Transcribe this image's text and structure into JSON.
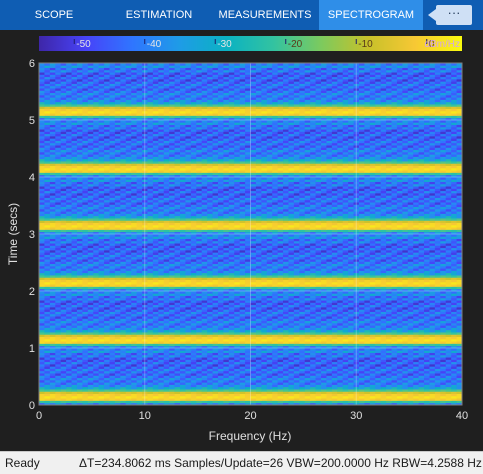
{
  "tabs": [
    {
      "label": "SCOPE",
      "active": false
    },
    {
      "label": "ESTIMATION",
      "active": false
    },
    {
      "label": "MEASUREMENTS",
      "active": false
    },
    {
      "label": "SPECTROGRAM",
      "active": true
    }
  ],
  "more_button": {
    "label": "···"
  },
  "colorbar": {
    "ticks": [
      "-50",
      "-40",
      "-30",
      "-20",
      "-10",
      "0"
    ],
    "unit": "dBm/Hz"
  },
  "status": {
    "ready": "Ready",
    "metrics": "ΔT=234.8062 ms  Samples/Update=26  VBW=200.0000 Hz  RBW=4.2588 Hz"
  },
  "chart_data": {
    "type": "heatmap",
    "xlabel": "Frequency (Hz)",
    "ylabel": "Time (secs)",
    "x_ticks": [
      "0",
      "10",
      "20",
      "30",
      "40"
    ],
    "y_ticks": [
      "0",
      "1",
      "2",
      "3",
      "4",
      "5",
      "6"
    ],
    "xlim": [
      0,
      40
    ],
    "ylim": [
      0,
      6
    ],
    "zlim": [
      -55,
      5
    ],
    "grid": true,
    "colormap": [
      "#3e26a8",
      "#4743f8",
      "#2f76ff",
      "#1e9ce6",
      "#0bb2c2",
      "#33c3a0",
      "#7cca5e",
      "#c7c12a",
      "#f7c834",
      "#f9fb0e"
    ],
    "period_secs": 1.0,
    "profile": [
      {
        "t": 0.0,
        "db": -44
      },
      {
        "t": 0.05,
        "db": -30
      },
      {
        "t": 0.08,
        "db": -5
      },
      {
        "t": 0.1,
        "db": -1
      },
      {
        "t": 0.14,
        "db": 1
      },
      {
        "t": 0.18,
        "db": -1
      },
      {
        "t": 0.22,
        "db": -6
      },
      {
        "t": 0.26,
        "db": -20
      },
      {
        "t": 0.31,
        "db": -34
      },
      {
        "t": 0.36,
        "db": -40
      },
      {
        "t": 0.41,
        "db": -42
      },
      {
        "t": 0.46,
        "db": -39
      },
      {
        "t": 0.5,
        "db": -42
      },
      {
        "t": 0.55,
        "db": -45
      },
      {
        "t": 0.6,
        "db": -41
      },
      {
        "t": 0.65,
        "db": -43
      },
      {
        "t": 0.7,
        "db": -46
      },
      {
        "t": 0.75,
        "db": -42
      },
      {
        "t": 0.8,
        "db": -48
      },
      {
        "t": 0.86,
        "db": -40
      },
      {
        "t": 0.91,
        "db": -44
      },
      {
        "t": 0.95,
        "db": -34
      },
      {
        "t": 1.0,
        "db": -44
      }
    ]
  }
}
